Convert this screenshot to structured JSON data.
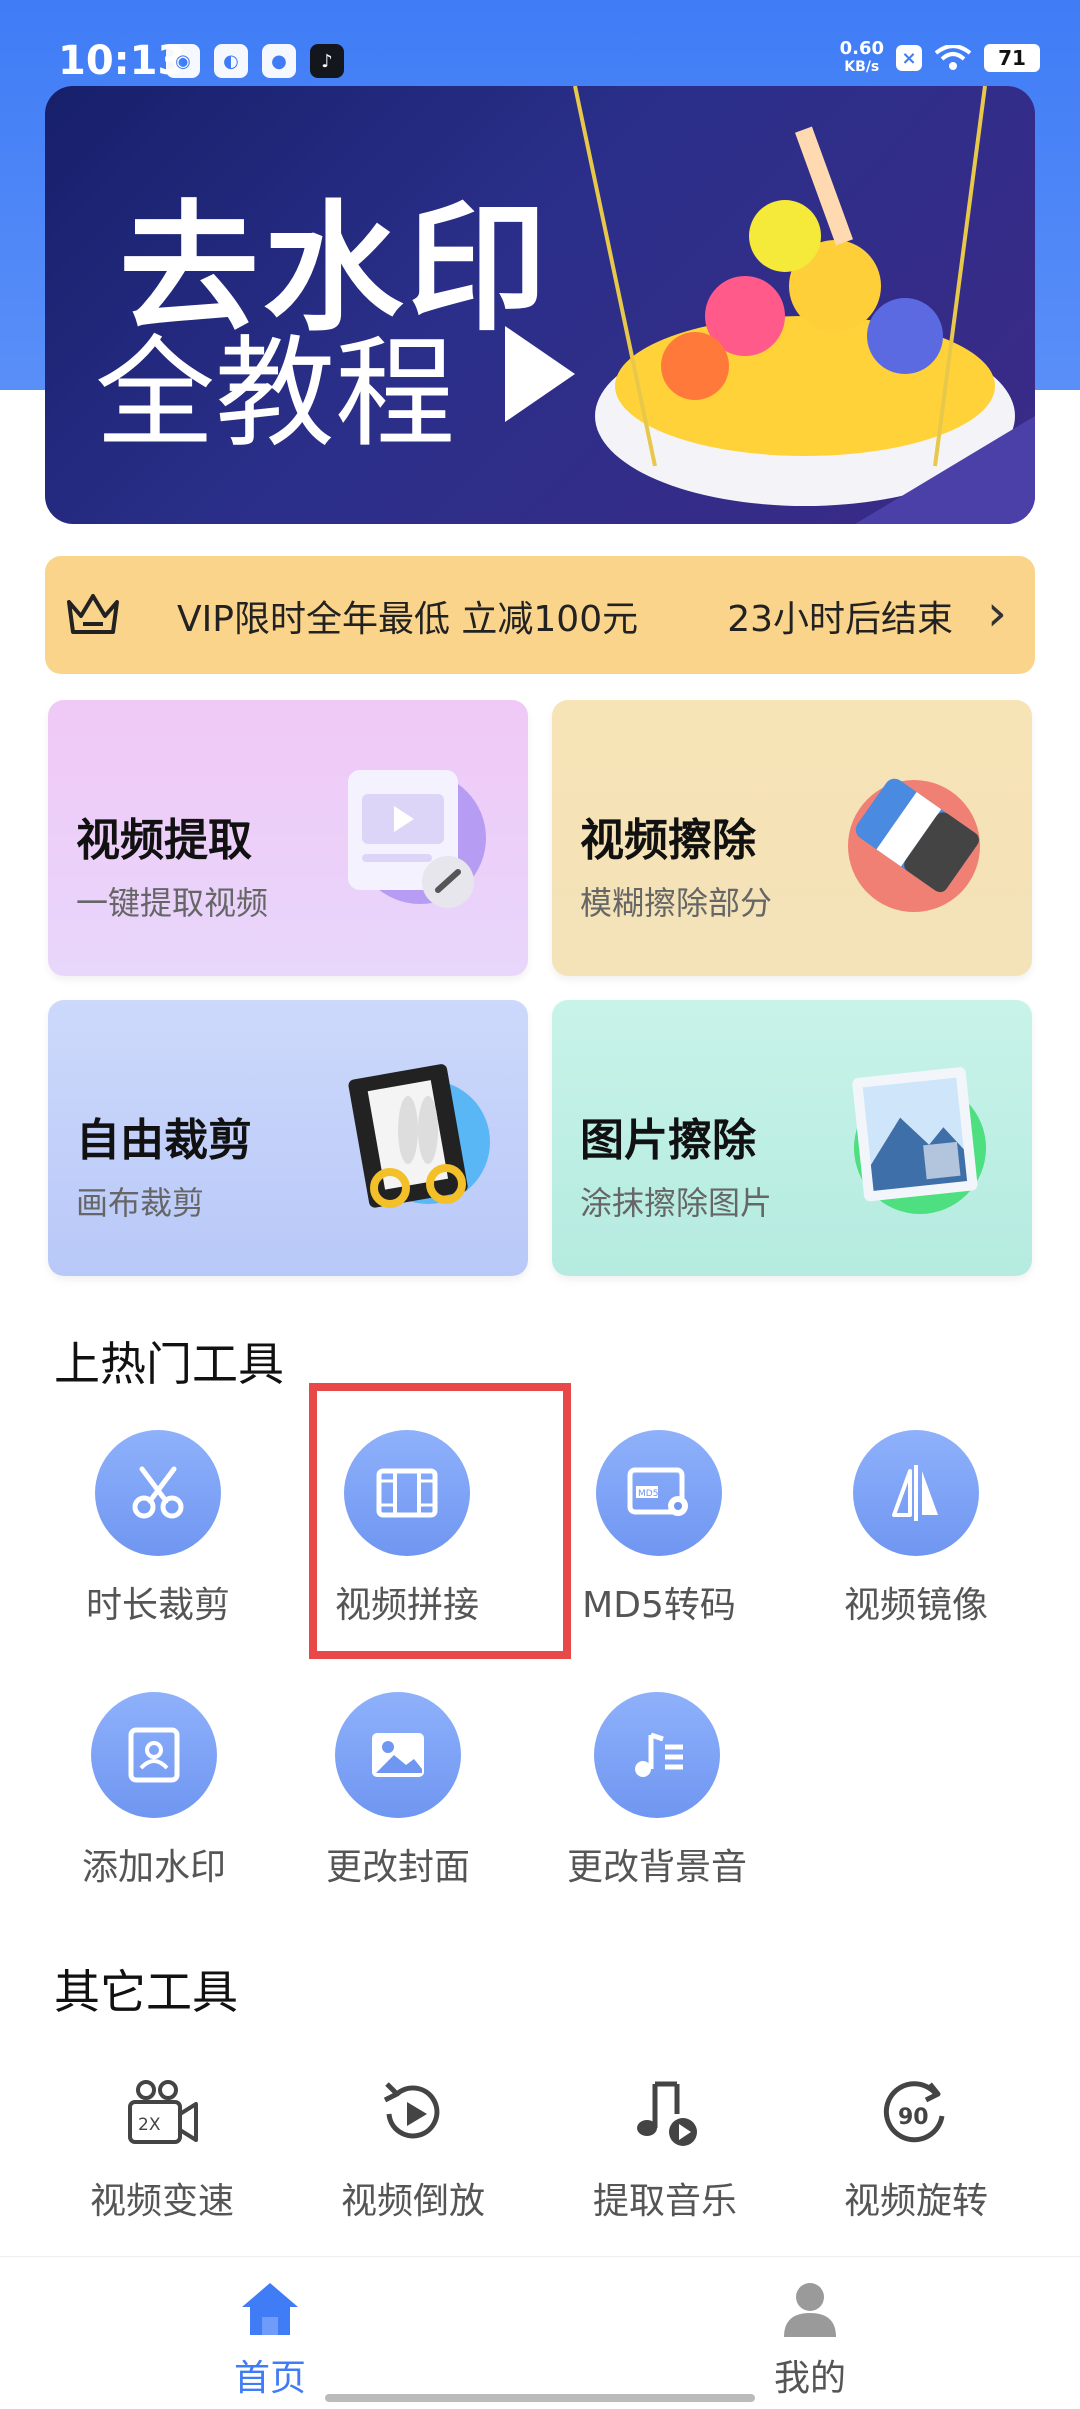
{
  "status_bar": {
    "time": "10:13",
    "speed_value": "0.60",
    "speed_unit": "KB/s",
    "battery": "71"
  },
  "banner": {
    "line1": "去水印",
    "line2": "全教程"
  },
  "vip": {
    "text": "VIP限时全年最低 立减100元",
    "countdown": "23小时后结束"
  },
  "feature_cards": [
    {
      "title": "视频提取",
      "subtitle": "一键提取视频"
    },
    {
      "title": "视频擦除",
      "subtitle": "模糊擦除部分"
    },
    {
      "title": "自由裁剪",
      "subtitle": "画布裁剪"
    },
    {
      "title": "图片擦除",
      "subtitle": "涂抹擦除图片"
    }
  ],
  "hot_tools": {
    "title": "上热门工具",
    "items": [
      {
        "label": "时长裁剪",
        "icon": "scissors-icon"
      },
      {
        "label": "视频拼接",
        "icon": "film-strip-icon"
      },
      {
        "label": "MD5转码",
        "icon": "md5-gear-icon"
      },
      {
        "label": "视频镜像",
        "icon": "mirror-icon"
      },
      {
        "label": "添加水印",
        "icon": "portrait-frame-icon"
      },
      {
        "label": "更改封面",
        "icon": "image-icon"
      },
      {
        "label": "更改背景音",
        "icon": "music-list-icon"
      }
    ]
  },
  "other_tools": {
    "title": "其它工具",
    "items": [
      {
        "label": "视频变速",
        "icon": "camera-2x-icon",
        "badge": "2X"
      },
      {
        "label": "视频倒放",
        "icon": "rewind-play-icon"
      },
      {
        "label": "提取音乐",
        "icon": "music-note-icon"
      },
      {
        "label": "视频旋转",
        "icon": "rotate-90-icon",
        "badge": "90"
      }
    ]
  },
  "tab_bar": {
    "home": "首页",
    "mine": "我的",
    "active_color": "#3f7cf6"
  }
}
